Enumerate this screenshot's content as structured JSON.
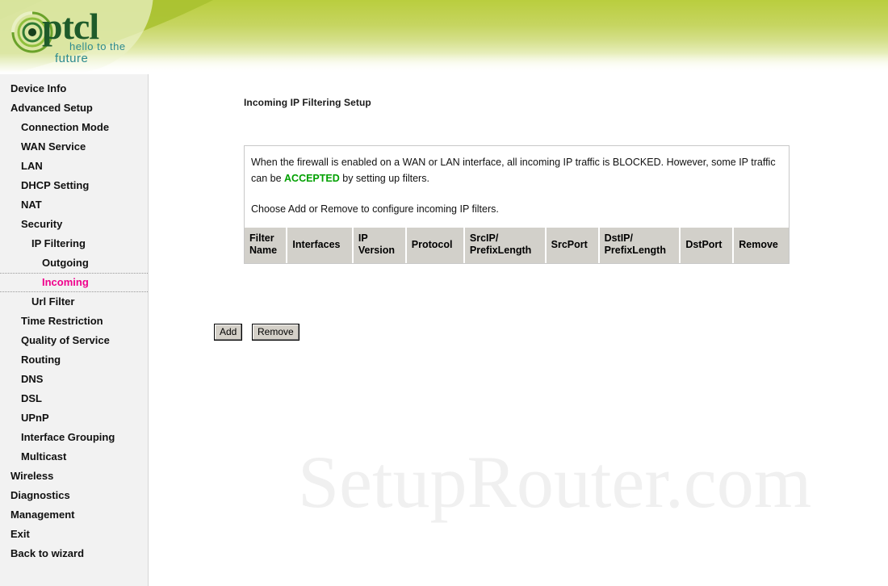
{
  "brand": {
    "logo_wordmark": "ptcl",
    "tagline_line1": "hello to the",
    "tagline_line2": "future",
    "accent_green": "#bed04a",
    "logo_green": "#1e5b2a",
    "tagline_teal": "#2d8a8f"
  },
  "sidebar": {
    "active_color": "#f0008c",
    "items": [
      {
        "label": "Device Info",
        "level": 0,
        "active": false
      },
      {
        "label": "Advanced Setup",
        "level": 0,
        "active": false
      },
      {
        "label": "Connection Mode",
        "level": 1,
        "active": false
      },
      {
        "label": "WAN Service",
        "level": 1,
        "active": false
      },
      {
        "label": "LAN",
        "level": 1,
        "active": false
      },
      {
        "label": "DHCP Setting",
        "level": 1,
        "active": false
      },
      {
        "label": "NAT",
        "level": 1,
        "active": false
      },
      {
        "label": "Security",
        "level": 1,
        "active": false
      },
      {
        "label": "IP Filtering",
        "level": 2,
        "active": false
      },
      {
        "label": "Outgoing",
        "level": 3,
        "active": false
      },
      {
        "label": "Incoming",
        "level": 3,
        "active": true
      },
      {
        "label": "Url Filter",
        "level": 2,
        "active": false
      },
      {
        "label": "Time Restriction",
        "level": 1,
        "active": false
      },
      {
        "label": "Quality of Service",
        "level": 1,
        "active": false
      },
      {
        "label": "Routing",
        "level": 1,
        "active": false
      },
      {
        "label": "DNS",
        "level": 1,
        "active": false
      },
      {
        "label": "DSL",
        "level": 1,
        "active": false
      },
      {
        "label": "UPnP",
        "level": 1,
        "active": false
      },
      {
        "label": "Interface Grouping",
        "level": 1,
        "active": false
      },
      {
        "label": "Multicast",
        "level": 1,
        "active": false
      },
      {
        "label": "Wireless",
        "level": 0,
        "active": false
      },
      {
        "label": "Diagnostics",
        "level": 0,
        "active": false
      },
      {
        "label": "Management",
        "level": 0,
        "active": false
      },
      {
        "label": "Exit",
        "level": 0,
        "active": false
      },
      {
        "label": "Back to wizard",
        "level": 0,
        "active": false
      }
    ]
  },
  "main": {
    "page_title": "Incoming IP Filtering Setup",
    "info": {
      "line1_a": "When the firewall is enabled on a WAN or LAN interface, all incoming IP traffic is BLOCKED. However, some IP traffic can be ",
      "line1_highlight": "ACCEPTED",
      "line1_b": " by setting up filters.",
      "highlight_color": "#00a000",
      "line2": "Choose Add or Remove to configure incoming IP filters."
    },
    "table": {
      "columns": [
        "Filter\nName",
        "Interfaces",
        "IP\nVersion",
        "Protocol",
        "SrcIP/\nPrefixLength",
        "SrcPort",
        "DstIP/\nPrefixLength",
        "DstPort",
        "Remove"
      ],
      "rows": []
    },
    "buttons": {
      "add": "Add",
      "remove": "Remove"
    }
  },
  "watermark": {
    "text": "SetupRouter.com"
  }
}
